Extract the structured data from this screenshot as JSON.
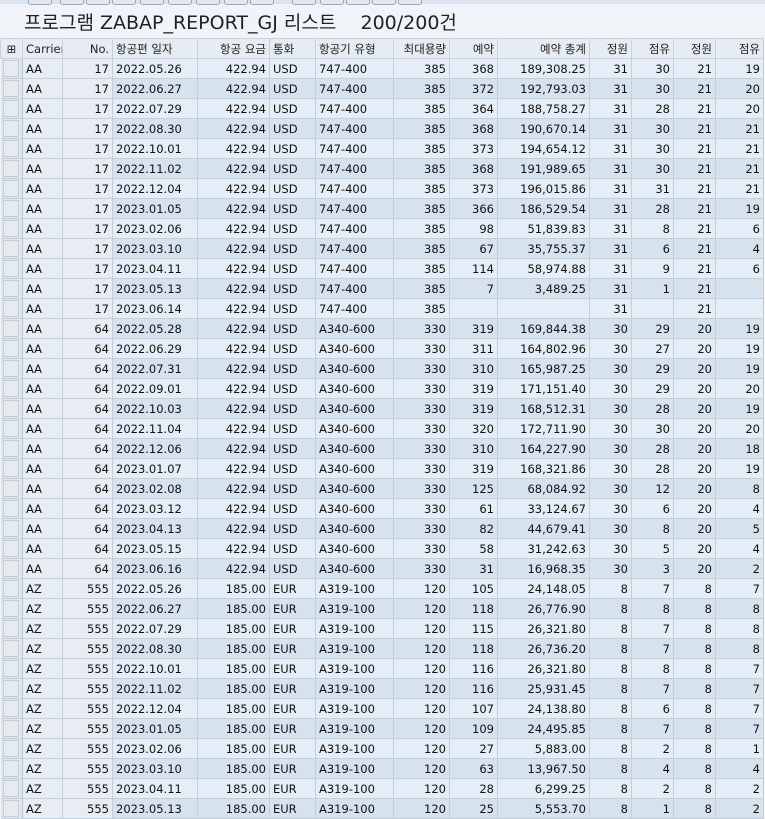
{
  "title": "프로그램 ZABAP_REPORT_GJ 리스트",
  "count": "200/200건",
  "columns": [
    "Carrier",
    "No.",
    "항공편 일자",
    "항공 요금",
    "통화",
    "항공기 유형",
    "최대용량",
    "예약",
    "예약 총계",
    "정원",
    "점유",
    "정원",
    "점유"
  ],
  "selector_header": "⊞",
  "rows": [
    [
      "AA",
      "17",
      "2022.05.26",
      "422.94",
      "USD",
      "747-400",
      "385",
      "368",
      "189,308.25",
      "31",
      "30",
      "21",
      "19"
    ],
    [
      "AA",
      "17",
      "2022.06.27",
      "422.94",
      "USD",
      "747-400",
      "385",
      "372",
      "192,793.03",
      "31",
      "30",
      "21",
      "20"
    ],
    [
      "AA",
      "17",
      "2022.07.29",
      "422.94",
      "USD",
      "747-400",
      "385",
      "364",
      "188,758.27",
      "31",
      "28",
      "21",
      "20"
    ],
    [
      "AA",
      "17",
      "2022.08.30",
      "422.94",
      "USD",
      "747-400",
      "385",
      "368",
      "190,670.14",
      "31",
      "30",
      "21",
      "21"
    ],
    [
      "AA",
      "17",
      "2022.10.01",
      "422.94",
      "USD",
      "747-400",
      "385",
      "373",
      "194,654.12",
      "31",
      "30",
      "21",
      "21"
    ],
    [
      "AA",
      "17",
      "2022.11.02",
      "422.94",
      "USD",
      "747-400",
      "385",
      "368",
      "191,989.65",
      "31",
      "30",
      "21",
      "21"
    ],
    [
      "AA",
      "17",
      "2022.12.04",
      "422.94",
      "USD",
      "747-400",
      "385",
      "373",
      "196,015.86",
      "31",
      "31",
      "21",
      "21"
    ],
    [
      "AA",
      "17",
      "2023.01.05",
      "422.94",
      "USD",
      "747-400",
      "385",
      "366",
      "186,529.54",
      "31",
      "28",
      "21",
      "19"
    ],
    [
      "AA",
      "17",
      "2023.02.06",
      "422.94",
      "USD",
      "747-400",
      "385",
      "98",
      "51,839.83",
      "31",
      "8",
      "21",
      "6"
    ],
    [
      "AA",
      "17",
      "2023.03.10",
      "422.94",
      "USD",
      "747-400",
      "385",
      "67",
      "35,755.37",
      "31",
      "6",
      "21",
      "4"
    ],
    [
      "AA",
      "17",
      "2023.04.11",
      "422.94",
      "USD",
      "747-400",
      "385",
      "114",
      "58,974.88",
      "31",
      "9",
      "21",
      "6"
    ],
    [
      "AA",
      "17",
      "2023.05.13",
      "422.94",
      "USD",
      "747-400",
      "385",
      "7",
      "3,489.25",
      "31",
      "1",
      "21",
      ""
    ],
    [
      "AA",
      "17",
      "2023.06.14",
      "422.94",
      "USD",
      "747-400",
      "385",
      "",
      "",
      "31",
      "",
      "21",
      ""
    ],
    [
      "AA",
      "64",
      "2022.05.28",
      "422.94",
      "USD",
      "A340-600",
      "330",
      "319",
      "169,844.38",
      "30",
      "29",
      "20",
      "19"
    ],
    [
      "AA",
      "64",
      "2022.06.29",
      "422.94",
      "USD",
      "A340-600",
      "330",
      "311",
      "164,802.96",
      "30",
      "27",
      "20",
      "19"
    ],
    [
      "AA",
      "64",
      "2022.07.31",
      "422.94",
      "USD",
      "A340-600",
      "330",
      "310",
      "165,987.25",
      "30",
      "29",
      "20",
      "19"
    ],
    [
      "AA",
      "64",
      "2022.09.01",
      "422.94",
      "USD",
      "A340-600",
      "330",
      "319",
      "171,151.40",
      "30",
      "29",
      "20",
      "20"
    ],
    [
      "AA",
      "64",
      "2022.10.03",
      "422.94",
      "USD",
      "A340-600",
      "330",
      "319",
      "168,512.31",
      "30",
      "28",
      "20",
      "19"
    ],
    [
      "AA",
      "64",
      "2022.11.04",
      "422.94",
      "USD",
      "A340-600",
      "330",
      "320",
      "172,711.90",
      "30",
      "30",
      "20",
      "20"
    ],
    [
      "AA",
      "64",
      "2022.12.06",
      "422.94",
      "USD",
      "A340-600",
      "330",
      "310",
      "164,227.90",
      "30",
      "28",
      "20",
      "18"
    ],
    [
      "AA",
      "64",
      "2023.01.07",
      "422.94",
      "USD",
      "A340-600",
      "330",
      "319",
      "168,321.86",
      "30",
      "28",
      "20",
      "19"
    ],
    [
      "AA",
      "64",
      "2023.02.08",
      "422.94",
      "USD",
      "A340-600",
      "330",
      "125",
      "68,084.92",
      "30",
      "12",
      "20",
      "8"
    ],
    [
      "AA",
      "64",
      "2023.03.12",
      "422.94",
      "USD",
      "A340-600",
      "330",
      "61",
      "33,124.67",
      "30",
      "6",
      "20",
      "4"
    ],
    [
      "AA",
      "64",
      "2023.04.13",
      "422.94",
      "USD",
      "A340-600",
      "330",
      "82",
      "44,679.41",
      "30",
      "8",
      "20",
      "5"
    ],
    [
      "AA",
      "64",
      "2023.05.15",
      "422.94",
      "USD",
      "A340-600",
      "330",
      "58",
      "31,242.63",
      "30",
      "5",
      "20",
      "4"
    ],
    [
      "AA",
      "64",
      "2023.06.16",
      "422.94",
      "USD",
      "A340-600",
      "330",
      "31",
      "16,968.35",
      "30",
      "3",
      "20",
      "2"
    ],
    [
      "AZ",
      "555",
      "2022.05.26",
      "185.00",
      "EUR",
      "A319-100",
      "120",
      "105",
      "24,148.05",
      "8",
      "7",
      "8",
      "7"
    ],
    [
      "AZ",
      "555",
      "2022.06.27",
      "185.00",
      "EUR",
      "A319-100",
      "120",
      "118",
      "26,776.90",
      "8",
      "8",
      "8",
      "8"
    ],
    [
      "AZ",
      "555",
      "2022.07.29",
      "185.00",
      "EUR",
      "A319-100",
      "120",
      "115",
      "26,321.80",
      "8",
      "7",
      "8",
      "8"
    ],
    [
      "AZ",
      "555",
      "2022.08.30",
      "185.00",
      "EUR",
      "A319-100",
      "120",
      "118",
      "26,736.20",
      "8",
      "7",
      "8",
      "8"
    ],
    [
      "AZ",
      "555",
      "2022.10.01",
      "185.00",
      "EUR",
      "A319-100",
      "120",
      "116",
      "26,321.80",
      "8",
      "8",
      "8",
      "7"
    ],
    [
      "AZ",
      "555",
      "2022.11.02",
      "185.00",
      "EUR",
      "A319-100",
      "120",
      "116",
      "25,931.45",
      "8",
      "7",
      "8",
      "7"
    ],
    [
      "AZ",
      "555",
      "2022.12.04",
      "185.00",
      "EUR",
      "A319-100",
      "120",
      "107",
      "24,138.80",
      "8",
      "6",
      "8",
      "7"
    ],
    [
      "AZ",
      "555",
      "2023.01.05",
      "185.00",
      "EUR",
      "A319-100",
      "120",
      "109",
      "24,495.85",
      "8",
      "7",
      "8",
      "7"
    ],
    [
      "AZ",
      "555",
      "2023.02.06",
      "185.00",
      "EUR",
      "A319-100",
      "120",
      "27",
      "5,883.00",
      "8",
      "2",
      "8",
      "1"
    ],
    [
      "AZ",
      "555",
      "2023.03.10",
      "185.00",
      "EUR",
      "A319-100",
      "120",
      "63",
      "13,967.50",
      "8",
      "4",
      "8",
      "4"
    ],
    [
      "AZ",
      "555",
      "2023.04.11",
      "185.00",
      "EUR",
      "A319-100",
      "120",
      "28",
      "6,299.25",
      "8",
      "2",
      "8",
      "2"
    ],
    [
      "AZ",
      "555",
      "2023.05.13",
      "185.00",
      "EUR",
      "A319-100",
      "120",
      "25",
      "5,553.70",
      "8",
      "1",
      "8",
      "2"
    ]
  ]
}
